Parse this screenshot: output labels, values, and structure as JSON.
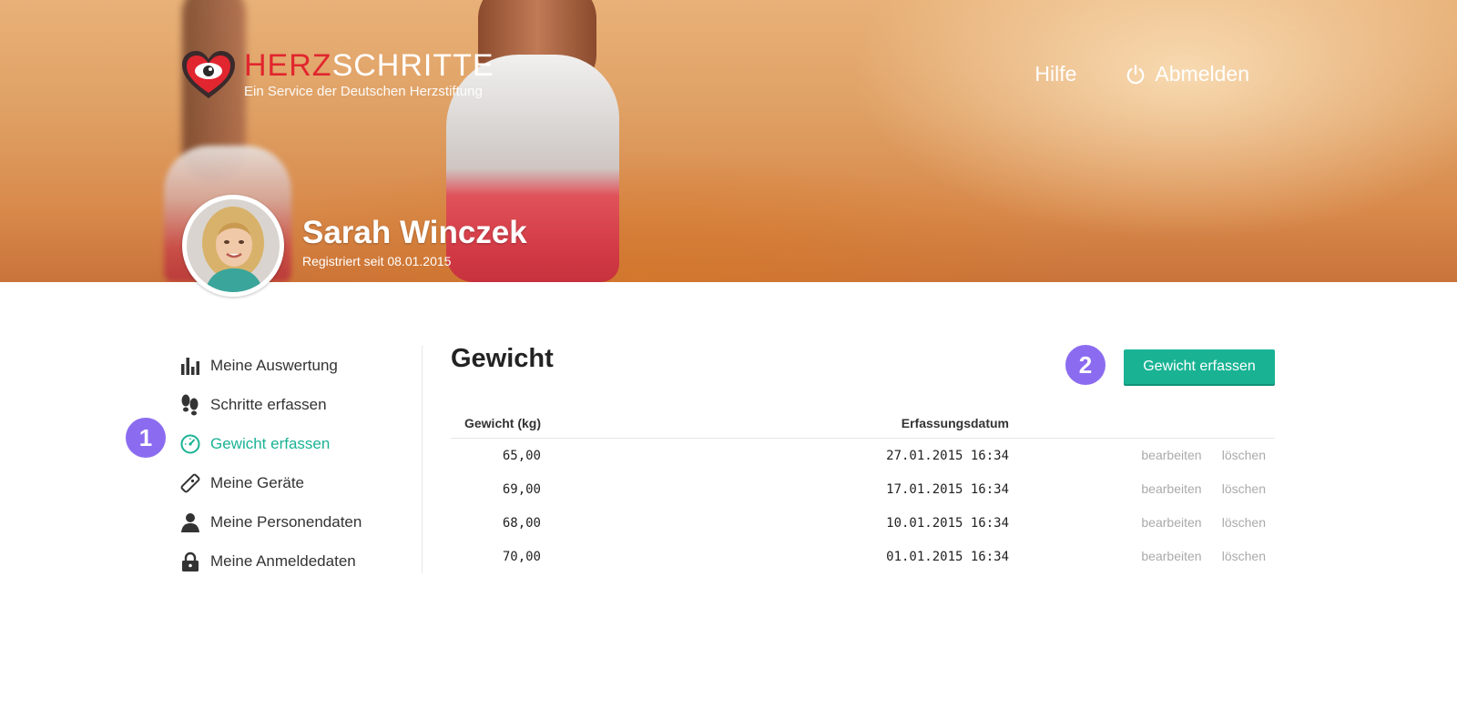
{
  "brand": {
    "name_part1": "HERZ",
    "name_part2": "SCHRITTE",
    "subtitle": "Ein Service der Deutschen Herzstiftung"
  },
  "topnav": {
    "help": "Hilfe",
    "logout": "Abmelden"
  },
  "profile": {
    "name": "Sarah Winczek",
    "registered": "Registriert seit 08.01.2015"
  },
  "sidebar": {
    "items": [
      {
        "label": "Meine Auswertung",
        "icon": "bar-chart-icon"
      },
      {
        "label": "Schritte erfassen",
        "icon": "footprints-icon"
      },
      {
        "label": "Gewicht erfassen",
        "icon": "scale-gauge-icon",
        "active": true
      },
      {
        "label": "Meine Geräte",
        "icon": "device-icon"
      },
      {
        "label": "Meine Personendaten",
        "icon": "person-icon"
      },
      {
        "label": "Meine Anmeldedaten",
        "icon": "lock-icon"
      }
    ]
  },
  "markers": {
    "one": "1",
    "two": "2"
  },
  "main": {
    "title": "Gewicht",
    "add_button": "Gewicht erfassen",
    "table": {
      "headers": {
        "weight": "Gewicht (kg)",
        "date": "Erfassungsdatum"
      },
      "rows": [
        {
          "weight": "65,00",
          "date": "27.01.2015 16:34"
        },
        {
          "weight": "69,00",
          "date": "17.01.2015 16:34"
        },
        {
          "weight": "68,00",
          "date": "10.01.2015 16:34"
        },
        {
          "weight": "70,00",
          "date": "01.01.2015 16:34"
        }
      ],
      "edit_label": "bearbeiten",
      "delete_label": "löschen"
    }
  },
  "colors": {
    "accent": "#19b394",
    "marker": "#8b6cf0",
    "brand_red": "#e1262f"
  }
}
